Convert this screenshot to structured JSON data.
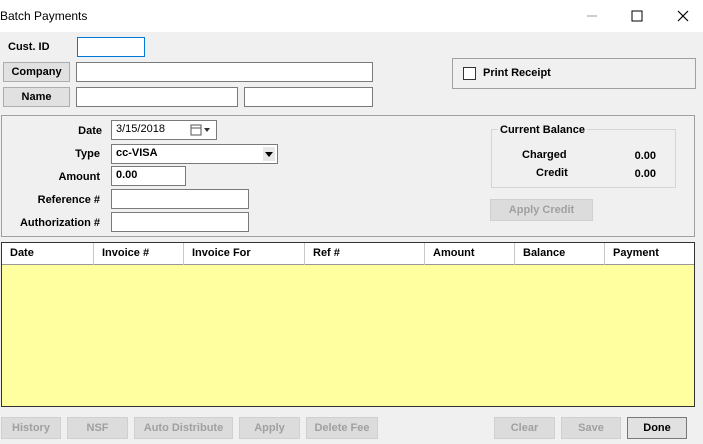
{
  "window": {
    "title": "Batch Payments"
  },
  "customer": {
    "cust_id_label": "Cust. ID",
    "cust_id_value": "",
    "company_label": "Company",
    "company_value": "",
    "name_label": "Name",
    "first_name_value": "",
    "last_name_value": ""
  },
  "print_receipt": {
    "label": "Print Receipt",
    "checked": false
  },
  "payment": {
    "date_label": "Date",
    "date_value": "3/15/2018",
    "type_label": "Type",
    "type_value": "cc-VISA",
    "amount_label": "Amount",
    "amount_value": "0.00",
    "reference_label": "Reference #",
    "reference_value": "",
    "authorization_label": "Authorization #",
    "authorization_value": ""
  },
  "balance": {
    "title": "Current Balance",
    "charged_label": "Charged",
    "charged_value": "0.00",
    "credit_label": "Credit",
    "credit_value": "0.00",
    "apply_credit_label": "Apply Credit"
  },
  "grid": {
    "columns": [
      "Date",
      "Invoice #",
      "Invoice For",
      "Ref #",
      "Amount",
      "Balance",
      "Payment"
    ],
    "rows": []
  },
  "footer": {
    "history": "History",
    "nsf": "NSF",
    "auto_distribute": "Auto Distribute",
    "apply": "Apply",
    "delete_fee": "Delete Fee",
    "clear": "Clear",
    "save": "Save",
    "done": "Done"
  },
  "colors": {
    "grid_background": "#ffffa0",
    "focus_border": "#0078d7"
  }
}
